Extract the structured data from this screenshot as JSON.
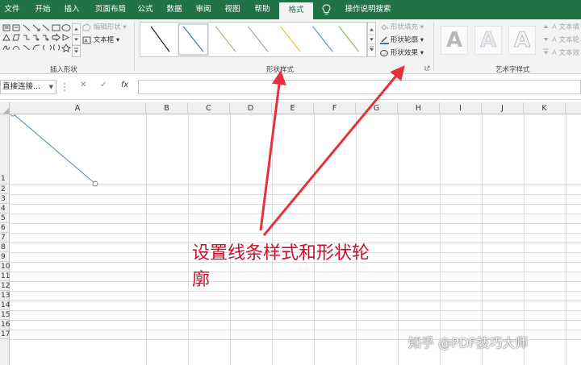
{
  "tabs": [
    {
      "label": "文件",
      "active": false
    },
    {
      "label": "开始",
      "active": false
    },
    {
      "label": "插入",
      "active": false
    },
    {
      "label": "页面布局",
      "active": false
    },
    {
      "label": "公式",
      "active": false
    },
    {
      "label": "数据",
      "active": false
    },
    {
      "label": "审阅",
      "active": false
    },
    {
      "label": "视图",
      "active": false
    },
    {
      "label": "帮助",
      "active": false
    },
    {
      "label": "格式",
      "active": true
    }
  ],
  "tell_me": "操作说明搜索",
  "ribbon": {
    "insert_shapes": {
      "label": "插入形状",
      "edit_shape": "编辑形状",
      "text_box": "文本框"
    },
    "shape_styles": {
      "label": "形状样式",
      "fill": "形状填充",
      "outline": "形状轮廓",
      "effects": "形状效果"
    },
    "wordart": {
      "label": "艺术字样式",
      "art_letter": "A",
      "text_fill": "文本填",
      "text_outline": "文本轮",
      "text_effects": "文本效"
    }
  },
  "formula_bar": {
    "name_box": "直接连接...",
    "cancel": "✕",
    "enter": "✓",
    "fx": "fx",
    "value": ""
  },
  "grid": {
    "columns": [
      "A",
      "B",
      "C",
      "D",
      "E",
      "F",
      "G",
      "H",
      "I",
      "J",
      "K"
    ],
    "rows": [
      "1",
      "2",
      "3",
      "4",
      "5",
      "6",
      "7",
      "8",
      "9",
      "10",
      "11",
      "12",
      "13",
      "14",
      "15",
      "16",
      "17"
    ]
  },
  "annotation": {
    "line1": "设置线条样式和形状轮",
    "line2": "廓"
  },
  "watermark": "知乎 @PDF技巧大师",
  "colors": {
    "excel_green": "#217346",
    "arrow_red": "#e8303c",
    "annotation_red": "#c8102e",
    "line_blue": "#5b8ac4"
  }
}
